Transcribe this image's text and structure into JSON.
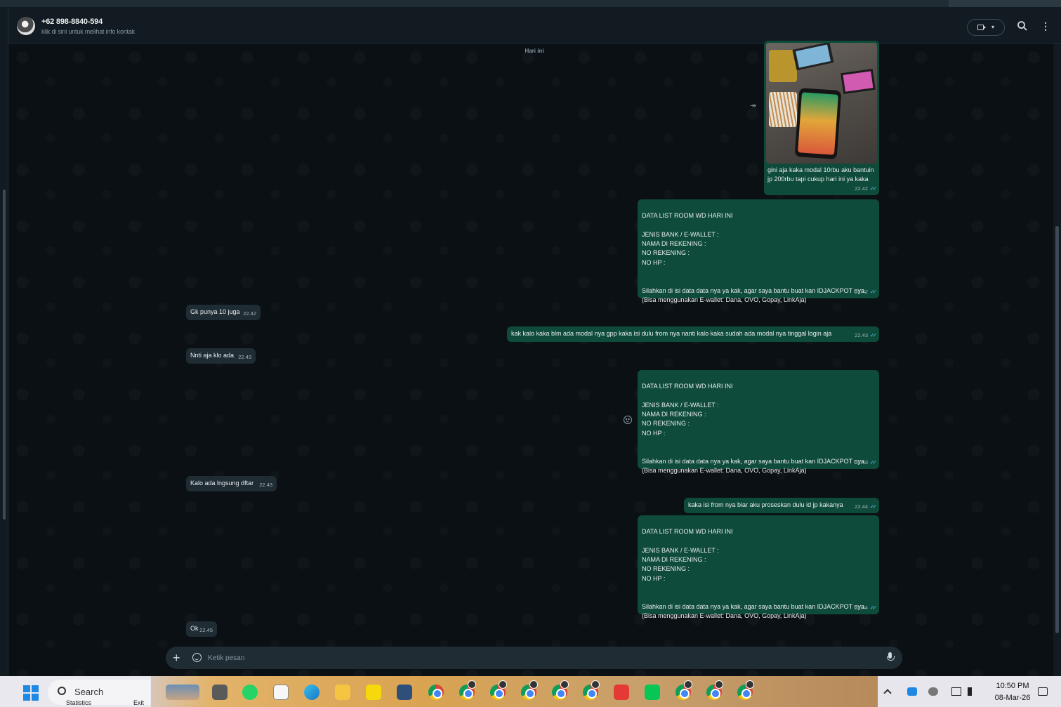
{
  "header": {
    "contact_name": "+62 898-8840-594",
    "contact_subtitle": "klik di sini untuk melihat info kontak",
    "icons": [
      "video-call-icon",
      "search-icon",
      "menu-icon"
    ]
  },
  "day_label": "Hari ini",
  "messages": [
    {
      "dir": "out",
      "type": "image",
      "caption": "gini aja kaka modal 10rbu aku bantuin jp 200rbu tapi cukup hari ini ya kaka",
      "time": "22.42"
    },
    {
      "dir": "out",
      "text": "DATA LIST ROOM WD HARI INI\n\nJENIS BANK / E-WALLET :\nNAMA DI REKENING :\nNO REKENING :\nNO HP :\n\n\nSilahkan di isi data data nya ya kak, agar saya bantu buat kan IDJACKPOT nya.\n(Bisa menggunakan E-wallet: Dana, OVO, Gopay, LinkAja)",
      "time": "22.42"
    },
    {
      "dir": "in",
      "text": "Gk punya 10 juga",
      "time": "22.42"
    },
    {
      "dir": "out",
      "text": "kak kalo kaka blm ada modal nya gpp kaka isi dulu from nya nanti kalo kaka sudah ada modal nya tinggal login aja",
      "time": "22.43"
    },
    {
      "dir": "in",
      "text": "Nnti aja klo ada",
      "time": "22.43"
    },
    {
      "dir": "out",
      "text": "DATA LIST ROOM WD HARI INI\n\nJENIS BANK / E-WALLET :\nNAMA DI REKENING :\nNO REKENING :\nNO HP :\n\n\nSilahkan di isi data data nya ya kak, agar saya bantu buat kan IDJACKPOT nya.\n(Bisa menggunakan E-wallet: Dana, OVO, Gopay, LinkAja)",
      "time": "22.43"
    },
    {
      "dir": "in",
      "text": "Kalo ada lngsung dftar",
      "time": "22.43"
    },
    {
      "dir": "out",
      "text": "kaka isi from nya biar aku proseskan dulu id jp kakanya",
      "time": "22.44"
    },
    {
      "dir": "out",
      "text": "DATA LIST ROOM WD HARI INI\n\nJENIS BANK / E-WALLET :\nNAMA DI REKENING :\nNO REKENING :\nNO HP :\n\n\nSilahkan di isi data data nya ya kak, agar saya bantu buat kan IDJACKPOT nya.\n(Bisa menggunakan E-wallet: Dana, OVO, Gopay, LinkAja)",
      "time": "22.44"
    },
    {
      "dir": "in",
      "text": "Ok",
      "time": "22.45"
    }
  ],
  "read_ticks": "✓✓",
  "forward_glyph": "↠",
  "composer": {
    "placeholder": "Ketik pesan",
    "plus_glyph": "+"
  },
  "taskbar": {
    "search_label": "Search",
    "widget_left": "Statistics",
    "widget_right": "Exit",
    "time": "10:50 PM",
    "date": "08-Mar-26"
  },
  "colors": {
    "chat_bg": "#0b1014",
    "bubble_in": "#1f2c33",
    "bubble_out": "#0f4b3a",
    "tick_read": "#53bdeb"
  }
}
